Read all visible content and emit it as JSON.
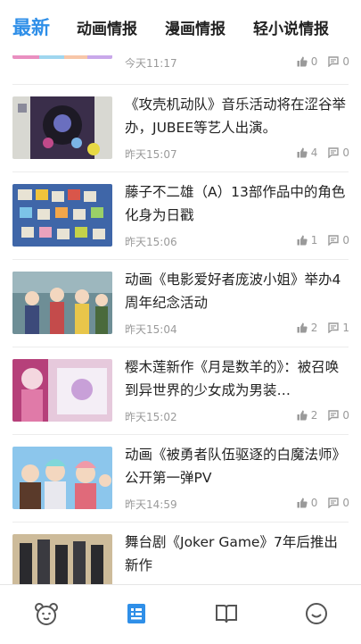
{
  "tabs": [
    "最新",
    "动画情报",
    "漫画情报",
    "轻小说情报"
  ],
  "articles": [
    {
      "title": "",
      "time": "今天11:17",
      "likes": "0",
      "comments": "0"
    },
    {
      "title": "《攻壳机动队》音乐活动将在涩谷举办，JUBEE等艺人出演。",
      "time": "昨天15:07",
      "likes": "4",
      "comments": "0"
    },
    {
      "title": "藤子不二雄（A）13部作品中的角色化身为日戳",
      "time": "昨天15:06",
      "likes": "1",
      "comments": "0"
    },
    {
      "title": "动画《电影爱好者庞波小姐》举办4周年纪念活动",
      "time": "昨天15:04",
      "likes": "2",
      "comments": "1"
    },
    {
      "title": "樱木莲新作《月是数羊的》：被召唤到异世界的少女成为男装…",
      "time": "昨天15:02",
      "likes": "2",
      "comments": "0"
    },
    {
      "title": "动画《被勇者队伍驱逐的白魔法师》公开第一弹PV",
      "time": "昨天14:59",
      "likes": "0",
      "comments": "0"
    },
    {
      "title": "舞台剧《Joker Game》7年后推出新作",
      "time": "",
      "likes": "",
      "comments": ""
    }
  ],
  "bottom_nav": [
    {
      "icon": "bear-face-icon",
      "active": false
    },
    {
      "icon": "news-list-icon",
      "active": true
    },
    {
      "icon": "open-book-icon",
      "active": false
    },
    {
      "icon": "smiley-icon",
      "active": false
    }
  ],
  "colors": {
    "accent": "#2f8fe8",
    "text": "#222222",
    "meta": "#9a9a9a"
  }
}
